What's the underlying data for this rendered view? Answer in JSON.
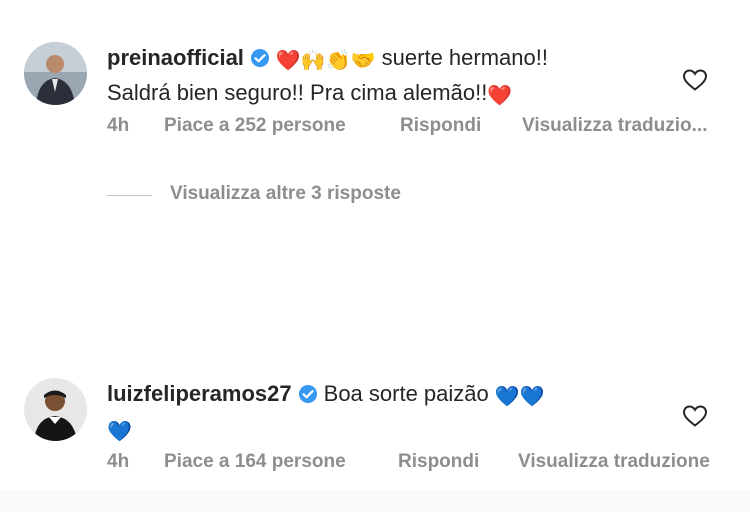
{
  "comments": [
    {
      "username": "preinaofficial",
      "verified": true,
      "emojis_line1": "❤️🙌👏🤝",
      "text_line1": "suerte hermano!!",
      "text_line2": "Saldrá bien seguro!! Pra cima alemão!!",
      "emoji_line2": "❤️",
      "time": "4h",
      "likes": "Piace a 252 persone",
      "reply": "Rispondi",
      "translate": "Visualizza traduzio..."
    },
    {
      "username": "luizfeliperamos27",
      "verified": true,
      "text_line1": "Boa sorte paizão",
      "emojis_line1": "💙💙",
      "emoji_line2": "💙",
      "time": "4h",
      "likes": "Piace a 164 persone",
      "reply": "Rispondi",
      "translate": "Visualizza traduzione"
    }
  ],
  "view_replies": "Visualizza altre 3 risposte",
  "colors": {
    "text": "#262626",
    "meta": "#8e8e8e",
    "verified": "#3897f0",
    "heart_red": "#ed1c24",
    "heart_blue": "#1e88e5"
  },
  "icons": {
    "like": "heart-outline-icon",
    "verified": "verified-badge-icon"
  }
}
